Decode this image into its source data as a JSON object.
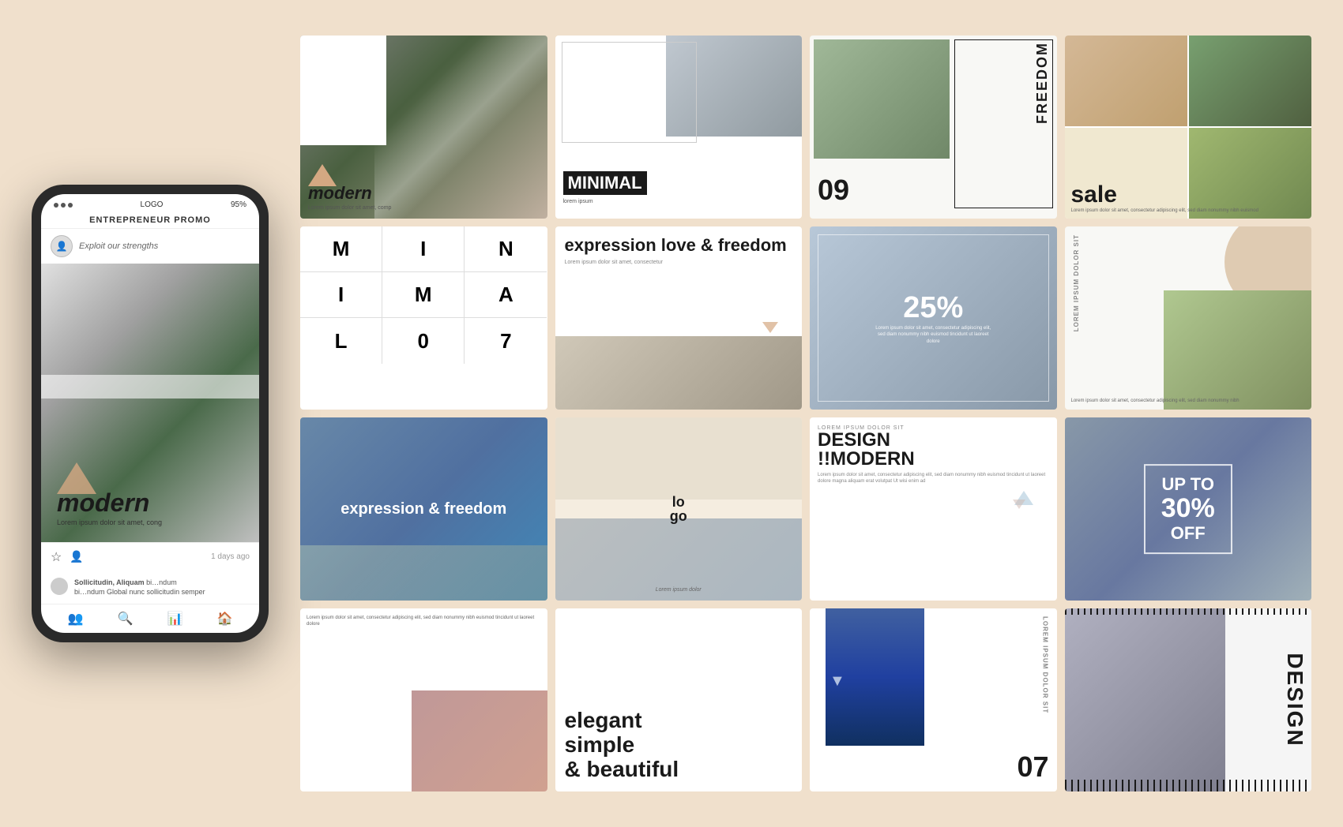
{
  "page": {
    "background": "#f0e0cc"
  },
  "phone": {
    "status": {
      "signal_dots": 3,
      "label": "LOGO",
      "battery": "95%"
    },
    "header": "ENTREPRENEUR PROMO",
    "username": "Exploit our strengths",
    "modern_text": "modern",
    "lorem_text": "Lorem ipsum dolor sit amet, cong",
    "days_ago": "1 days ago",
    "comment_user": "Sollicitudin, Aliquam",
    "comment_text": "bi…ndum\nGlobal nunc sollicitudin semper"
  },
  "templates": {
    "row1": {
      "card1": {
        "title": "modern",
        "subtitle": "Lorem ipsum dolor sit amet, comp"
      },
      "card2": {
        "title": "MINIMAL",
        "subtitle": "lorem ipsum"
      },
      "card3": {
        "word": "FREEDOM",
        "number": "09"
      },
      "card4": {
        "title": "sale",
        "text": "Lorem ipsum dolor sit amet, consectetur adipiscing elit, sed diam nonummy nibh euismod"
      }
    },
    "row2": {
      "card1": {
        "letters": [
          "M",
          "I",
          "N",
          "I",
          "M",
          "A",
          "L",
          "0",
          "7"
        ]
      },
      "card2": {
        "title": "expression love & freedom",
        "subtitle": "Lorem ipsum dolor sit amet, consectetur"
      },
      "card3": {
        "percent": "25%",
        "text": "Lorem ipsum dolor sit amet, consectetur adipiscing elit, sed diam nonummy nibh euismod tincidunt ut laoreet dolore"
      },
      "card4": {
        "label": "LOREM IPSUM DOLOR SIT",
        "text": "Lorem ipsum dolor sit amet, consectetur adipiscing elit, sed diam nonummy nibh"
      }
    },
    "row3": {
      "card1": {
        "title": "expression & freedom"
      },
      "card2": {
        "logo": "lo\ngo",
        "subtitle": "Lorem ipsum dolor"
      },
      "card3": {
        "label": "LOREM IPSUM DOLOR SIT",
        "title": "DESIGN\n!!MODERN",
        "text": "Lorem ipsum dolor sit amet, consectetur adipiscing elit, sed diam nonummy nibh euismod tincidunt ut laoreet dolore magna\naliquam erat volutpat Ut wisi enim ad"
      },
      "card4": {
        "line1": "UP TO",
        "line2": "30%",
        "line3": "OFF"
      }
    },
    "row4": {
      "card1": {
        "text": "Lorem ipsum dolor sit amet, consectetur adipiscing elit, sed diam nonummy nibh euismod tincidunt ut laoreet dolore"
      },
      "card2": {
        "title": "elegant\nsimple\n& beautiful"
      },
      "card3": {
        "label": "LOREM IPSUM DOLOR SIT",
        "number": "07"
      },
      "card4": {
        "title": "DESIGN"
      }
    }
  }
}
